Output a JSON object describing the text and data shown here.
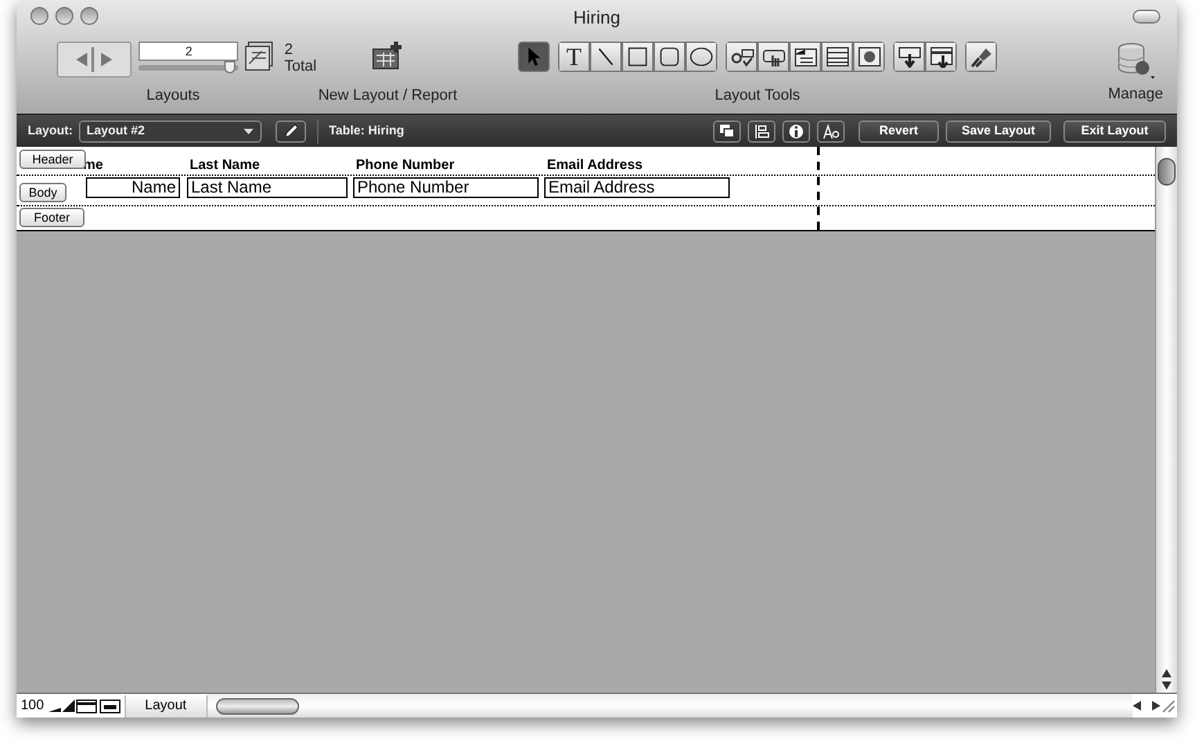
{
  "window": {
    "title": "Hiring"
  },
  "toolbar": {
    "record_number": "2",
    "layout_slider": {
      "level": 0.97
    },
    "total_count": "2",
    "total_label": "Total",
    "layouts_label": "Layouts",
    "new_layout_label": "New Layout / Report",
    "tools_label": "Layout Tools",
    "manage_label": "Manage",
    "tools": [
      {
        "kind": "pointer",
        "selected": true
      },
      {
        "kind": "text",
        "label": "T",
        "selected": false
      },
      {
        "kind": "line",
        "selected": false
      },
      {
        "kind": "rect",
        "selected": false
      },
      {
        "kind": "rounded",
        "selected": false
      },
      {
        "kind": "oval",
        "selected": false
      }
    ]
  },
  "layout_bar": {
    "layout_label": "Layout:",
    "layout_value": "Layout #2",
    "table_label": "Table: Hiring",
    "buttons": [
      "Revert",
      "Save Layout",
      "Exit Layout"
    ]
  },
  "parts": [
    "Header",
    "Body",
    "Footer"
  ],
  "headings": [
    "me",
    "Last Name",
    "Phone Number",
    "Email Address"
  ],
  "fields": [
    "Name",
    "Last Name",
    "Phone Number",
    "Email Address"
  ],
  "status_bar": {
    "zoom": "100",
    "mode": "Layout"
  }
}
